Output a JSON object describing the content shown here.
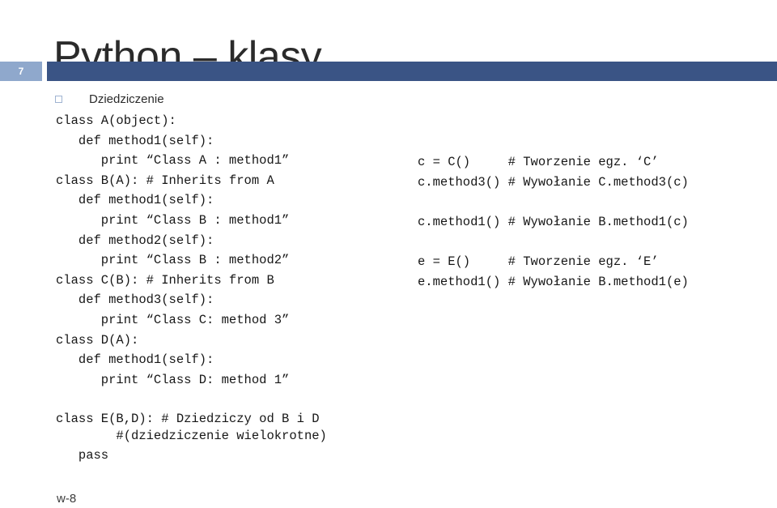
{
  "slide": {
    "title": "Python – klasy",
    "page_number": "7",
    "footer": "w-8",
    "accent_dark": "#3a5485",
    "accent_light": "#8fa8cc",
    "text_color": "#2b2b2b"
  },
  "bullet": {
    "icon": "square-bullet-icon",
    "label": "Dziedziczenie"
  },
  "code_left": {
    "lines": [
      "class A(object):",
      "   def method1(self):",
      "      print “Class A : method1”",
      "class B(A): # Inherits from A",
      "   def method1(self):",
      "      print “Class B : method1”",
      "   def method2(self):",
      "      print “Class B : method2”",
      "class C(B): # Inherits from B",
      "   def method3(self):",
      "      print “Class C: method 3”",
      "class D(A):",
      "   def method1(self):",
      "      print “Class D: method 1”"
    ]
  },
  "code_right": {
    "lines": [
      "c = C()     # Tworzenie egz. ‘C’",
      "c.method3() # Wywołanie C.method3(c)",
      "",
      "c.method1() # Wywołanie B.method1(c)",
      "",
      "e = E()     # Tworzenie egz. ‘E’",
      "e.method1() # Wywołanie B.method1(e)"
    ]
  },
  "code_bottom": {
    "lines": [
      "class E(B,D): # Dziedziczy od B i D",
      "        #(dziedziczenie wielokrotne)",
      "   pass"
    ]
  }
}
